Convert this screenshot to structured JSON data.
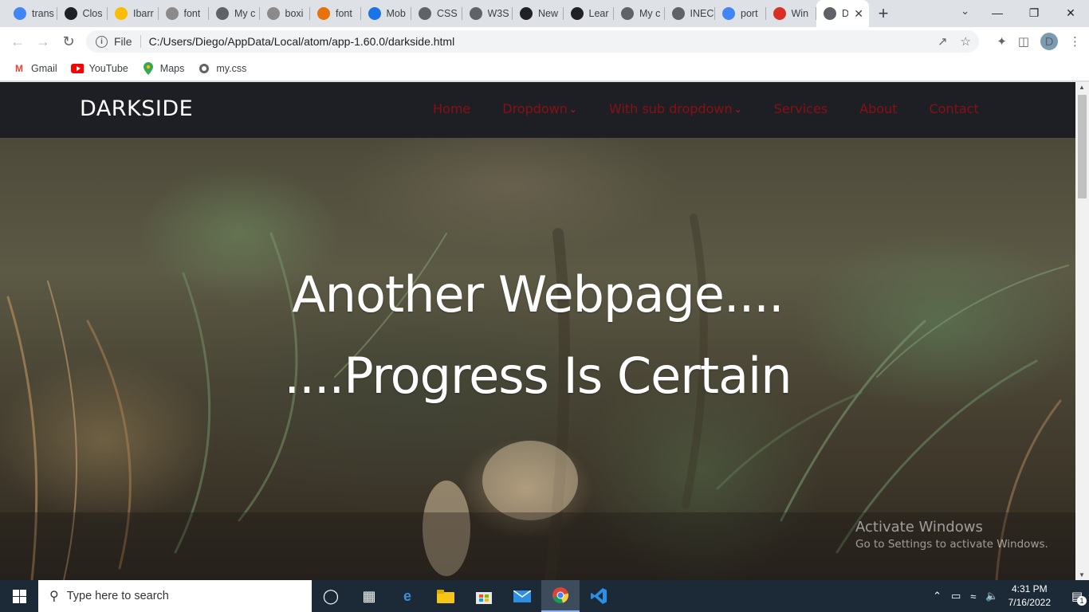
{
  "browser": {
    "tabs": [
      {
        "title": "trans",
        "icon": "google-icon",
        "color": "#4285f4"
      },
      {
        "title": "Clos",
        "icon": "drive-icon",
        "color": "#202124"
      },
      {
        "title": "Ibarr",
        "icon": "grid-icon",
        "color": "#fbbc04"
      },
      {
        "title": "font",
        "icon": "puzzle-icon",
        "color": "#8a8a8a"
      },
      {
        "title": "My c",
        "icon": "globe-icon",
        "color": "#5f6368"
      },
      {
        "title": "boxi",
        "icon": "box-icon",
        "color": "#8a8a8a"
      },
      {
        "title": "font",
        "icon": "code-icon",
        "color": "#e8710a"
      },
      {
        "title": "Mob",
        "icon": "flag-icon",
        "color": "#1a73e8"
      },
      {
        "title": "CSS",
        "icon": "globe-icon",
        "color": "#5f6368"
      },
      {
        "title": "W3S",
        "icon": "globe-icon",
        "color": "#5f6368"
      },
      {
        "title": "New",
        "icon": "github-icon",
        "color": "#202124"
      },
      {
        "title": "Lear",
        "icon": "bracket-icon",
        "color": "#202124"
      },
      {
        "title": "My c",
        "icon": "globe-icon",
        "color": "#5f6368"
      },
      {
        "title": "INEC",
        "icon": "globe-icon",
        "color": "#5f6368"
      },
      {
        "title": "port",
        "icon": "google-icon",
        "color": "#4285f4"
      },
      {
        "title": "Win",
        "icon": "c-icon",
        "color": "#d93025"
      },
      {
        "title": "D",
        "icon": "globe-icon",
        "color": "#5f6368",
        "active": true
      }
    ],
    "address": {
      "scheme_label": "File",
      "url": "C:/Users/Diego/AppData/Local/atom/app-1.60.0/darkside.html"
    },
    "profile_initial": "D",
    "bookmarks": [
      {
        "label": "Gmail",
        "icon": "gmail-icon",
        "color": "#ea4335"
      },
      {
        "label": "YouTube",
        "icon": "youtube-icon",
        "color": "#ff0000"
      },
      {
        "label": "Maps",
        "icon": "maps-icon",
        "color": "#34a853"
      },
      {
        "label": "my.css",
        "icon": "globe-icon",
        "color": "#5f6368"
      }
    ]
  },
  "site": {
    "logo": "DARKSIDE",
    "menu": {
      "home": "Home",
      "dropdown": "Dropdown",
      "sub_dropdown": "With sub dropdown",
      "services": "Services",
      "about": "About",
      "contact": "Contact"
    },
    "hero": {
      "line1": "Another Webpage....",
      "line2": "....Progress Is Certain"
    },
    "colors": {
      "nav_bg": "#1e1f24",
      "menu": "#8a0f13",
      "logo": "#ffffff"
    }
  },
  "watermark": {
    "title": "Activate Windows",
    "subtitle": "Go to Settings to activate Windows."
  },
  "taskbar": {
    "search_placeholder": "Type here to search",
    "time": "4:31 PM",
    "date": "7/16/2022",
    "notifications": "1"
  }
}
